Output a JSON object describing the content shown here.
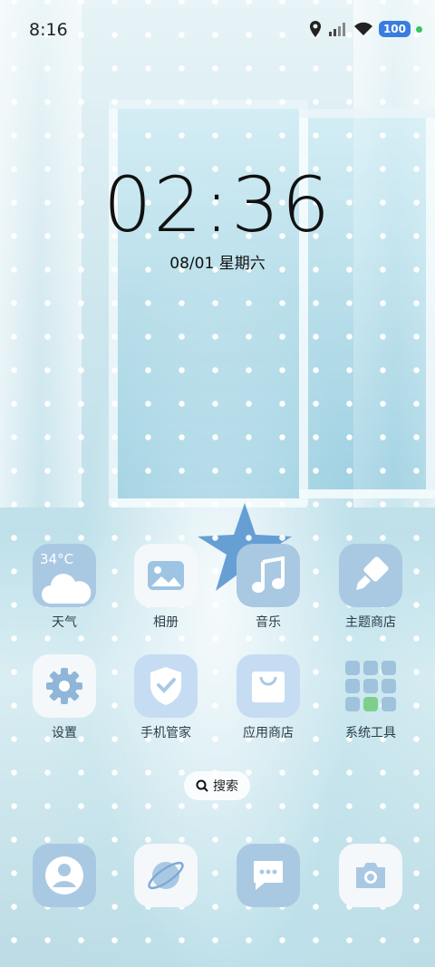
{
  "status": {
    "time": "8:16",
    "battery": "100"
  },
  "lockscreen": {
    "clock": "02:36",
    "date": "08/01 星期六"
  },
  "apps": [
    {
      "label": "天气",
      "icon": "weather-icon",
      "temp": "34°C"
    },
    {
      "label": "相册",
      "icon": "gallery-icon"
    },
    {
      "label": "音乐",
      "icon": "music-icon"
    },
    {
      "label": "主题商店",
      "icon": "theme-store-icon"
    },
    {
      "label": "设置",
      "icon": "settings-gear-icon"
    },
    {
      "label": "手机管家",
      "icon": "security-shield-icon"
    },
    {
      "label": "应用商店",
      "icon": "app-store-bag-icon"
    },
    {
      "label": "系统工具",
      "icon": "folder-icon"
    }
  ],
  "search": {
    "label": "搜索"
  },
  "dock": [
    {
      "icon": "contacts-icon"
    },
    {
      "icon": "browser-icon"
    },
    {
      "icon": "messages-icon"
    },
    {
      "icon": "camera-icon"
    }
  ],
  "colors": {
    "tile_blue": "#a9c9e3",
    "battery": "#3a7de0",
    "status_dot": "#34c759"
  }
}
